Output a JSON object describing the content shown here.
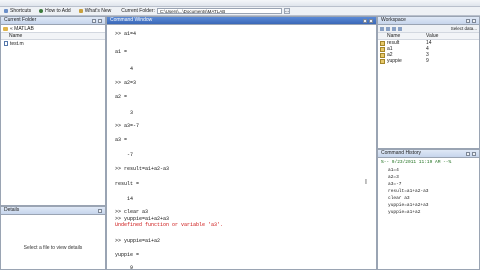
{
  "shortcuts": {
    "items": [
      {
        "label": "Shortcuts",
        "icon": "shortcut-icon"
      },
      {
        "label": "How to Add",
        "icon": "help-icon"
      },
      {
        "label": "What's New",
        "icon": "whats-new-icon"
      }
    ],
    "current_folder_label": "Current Folder:",
    "current_folder_path": "C:\\Users\\...\\Documents\\MATLAB",
    "browse_label": "..."
  },
  "folder_panel": {
    "title": "Current Folder",
    "path": "« MATLAB",
    "column_name": "Name",
    "files": [
      {
        "name": "test.m"
      }
    ]
  },
  "details_panel": {
    "title": "Details",
    "message": "Select a file to view details"
  },
  "command_window": {
    "title": "Command Window",
    "lines": [
      ">> a1=4",
      "a1 =",
      "     4",
      ">> a2=3",
      "a2 =",
      "     3",
      ">> a3=-7",
      "a3 =",
      "    -7",
      ">> result=a1+a2-a3",
      "result =",
      "    14",
      ">> clear a3",
      ">> yuppie=a1+a2+a3",
      "Undefined function or variable 'a3'.",
      ">> yuppie=a1+a2",
      "yuppie =",
      "     9"
    ]
  },
  "workspace": {
    "title": "Workspace",
    "select_label": "Select data...",
    "col_name": "Name",
    "col_value": "Value",
    "vars": [
      {
        "name": "result",
        "value": "14"
      },
      {
        "name": "a1",
        "value": "4"
      },
      {
        "name": "a2",
        "value": "3"
      },
      {
        "name": "yuppie",
        "value": "9"
      }
    ]
  },
  "history": {
    "title": "Command History",
    "lines": [
      "a1=4",
      "a2=3",
      "a3=-7",
      "result=a1+a2-a3",
      "clear a3",
      "yuppie=a1+a2+a3",
      "yuppie=a1+a2"
    ],
    "separator": "%-- 9/23/2011 11:19 AM --%"
  },
  "colors": {
    "active_title": "#3a68b8",
    "error_text": "#cc1111",
    "history_separator": "#1b6e1b"
  }
}
